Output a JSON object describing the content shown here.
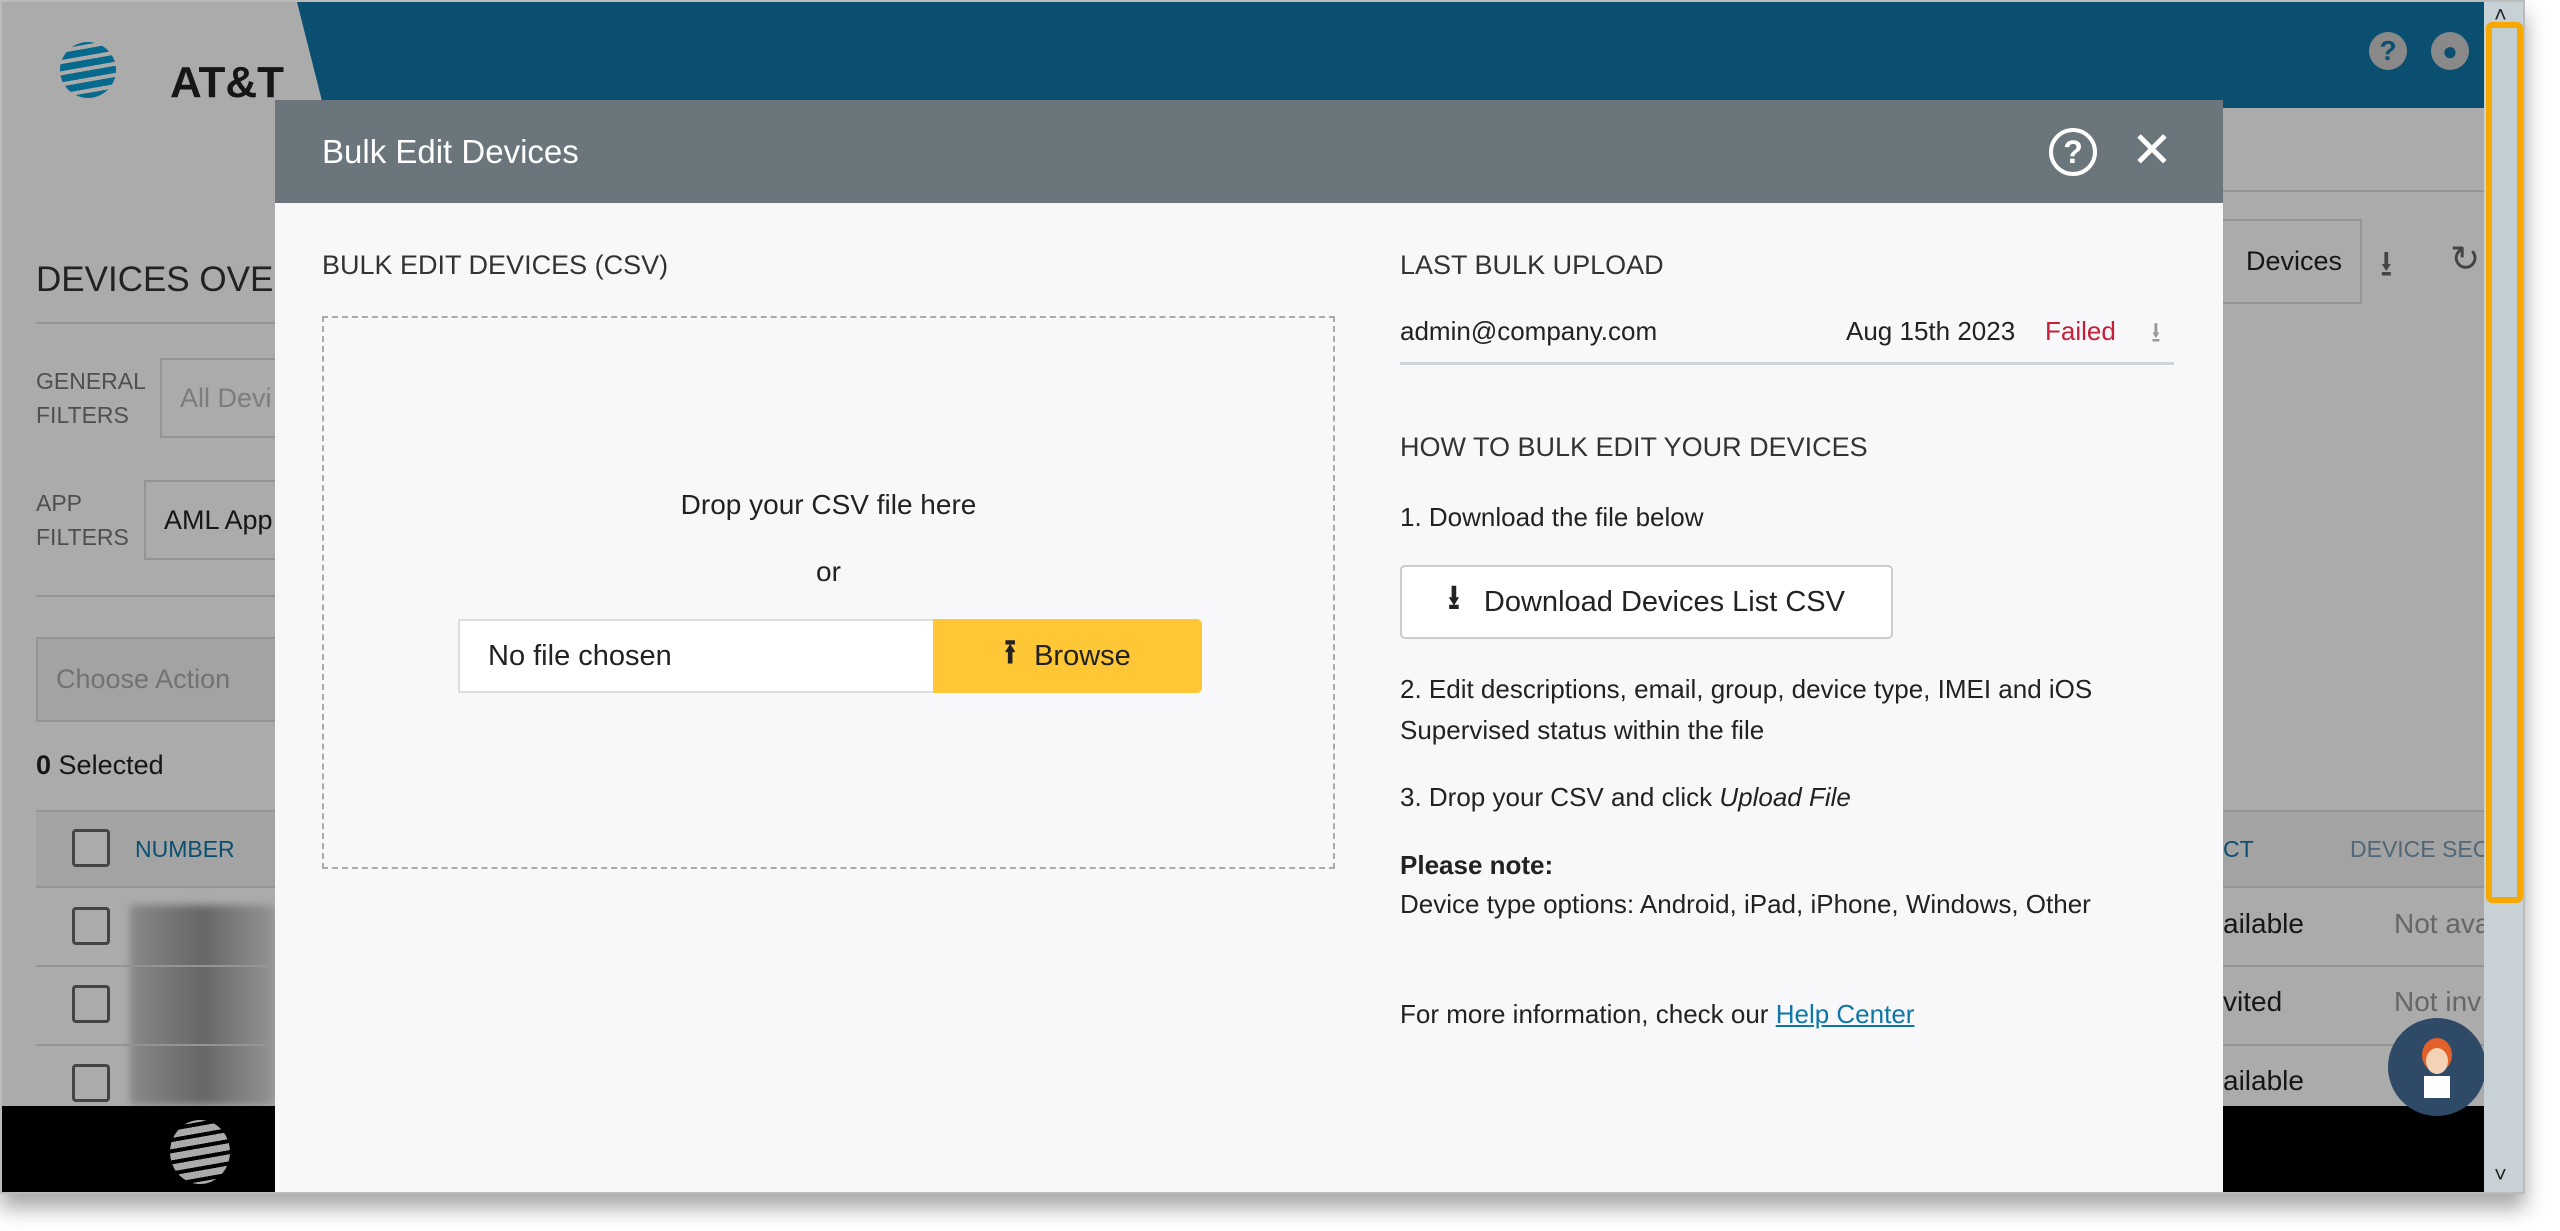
{
  "app": {
    "brand": "AT&T",
    "colors": {
      "header": "#0f76a8",
      "accent": "#ffc735",
      "failed": "#c4203b",
      "link": "#0f76a8",
      "scroll_highlight": "#f7a800"
    }
  },
  "background": {
    "page_title": "DEVICES OVER",
    "general_filters_label": [
      "GENERAL",
      "FILTERS"
    ],
    "general_filters_value": "All Devi",
    "app_filters_label": [
      "APP",
      "FILTERS"
    ],
    "app_filters_value": "AML App",
    "choose_action": "Choose Action",
    "selected_count": "0",
    "selected_label": "Selected",
    "devices_button": "Devices",
    "columns": [
      "NUMBER",
      "CT",
      "DEVICE SEC"
    ],
    "rows": [
      [
        "ailable",
        "Not ava"
      ],
      [
        "vited",
        "Not inv"
      ],
      [
        "ailable",
        ""
      ]
    ]
  },
  "modal": {
    "title": "Bulk Edit Devices",
    "left": {
      "heading": "BULK EDIT DEVICES (CSV)",
      "drop_text": "Drop your CSV file here",
      "or": "or",
      "file_value": "No file chosen",
      "browse": "Browse"
    },
    "right": {
      "last_heading": "LAST BULK UPLOAD",
      "last_user": "admin@company.com",
      "last_date": "Aug 15th 2023",
      "last_status": "Failed",
      "how_heading": "HOW TO BULK EDIT YOUR DEVICES",
      "step1": "1. Download the file below",
      "download_button": "Download Devices List CSV",
      "step2_line1": "2. Edit descriptions, email, group, device type, IMEI and iOS",
      "step2_line2": "Supervised status within the file",
      "step3_prefix": "3. Drop your CSV and click ",
      "step3_em": "Upload File",
      "note_title": "Please note:",
      "note_text": "Device type options: Android, iPad, iPhone, Windows, Other",
      "more_prefix": "For more information, check our ",
      "more_link": "Help Center"
    }
  }
}
